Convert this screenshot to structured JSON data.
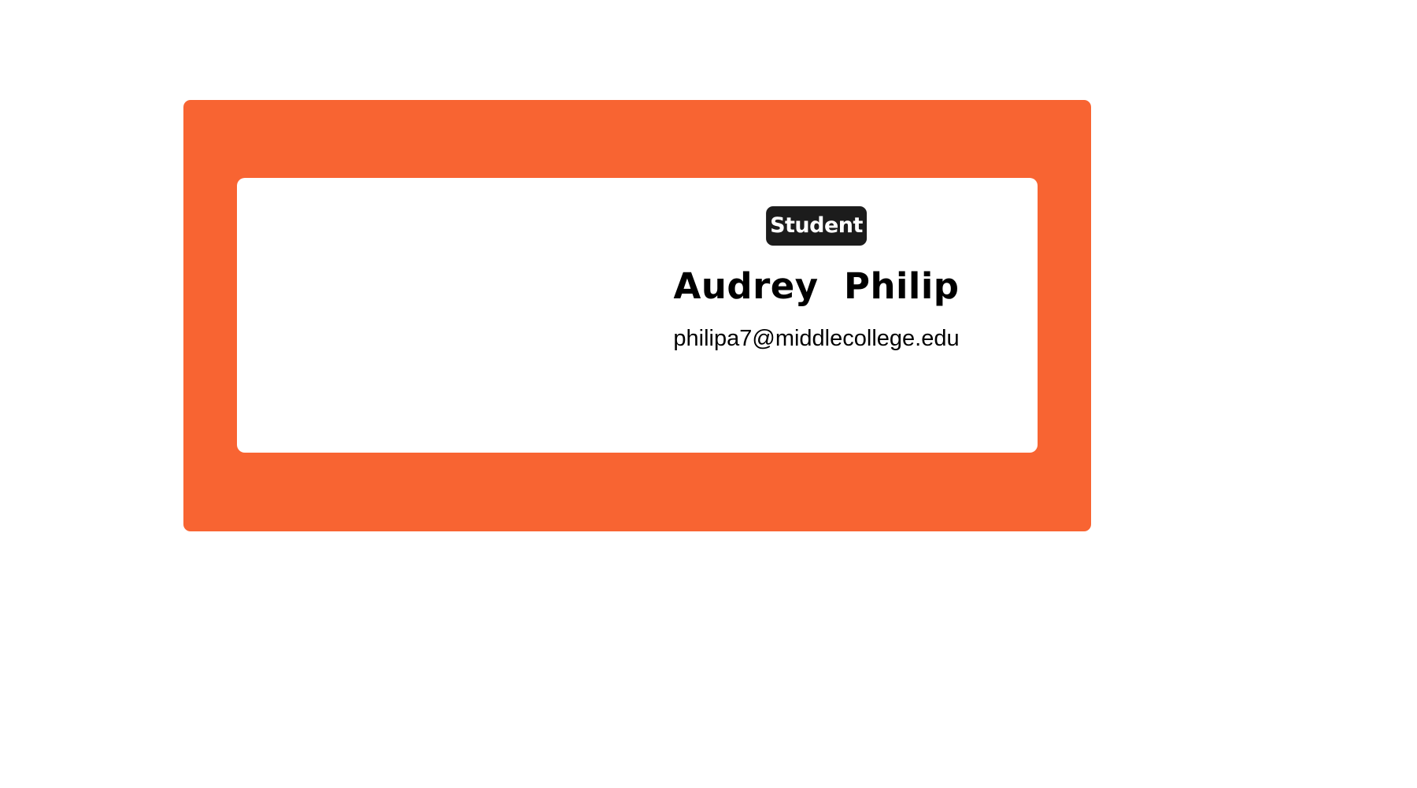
{
  "card": {
    "role_badge": "Student",
    "name": "Audrey  Philip",
    "email": "philipa7@middlecollege.edu"
  },
  "colors": {
    "frame": "#f86432",
    "badge_background": "#1c1c1c",
    "badge_text": "#ffffff",
    "text": "#000000",
    "background": "#ffffff"
  }
}
